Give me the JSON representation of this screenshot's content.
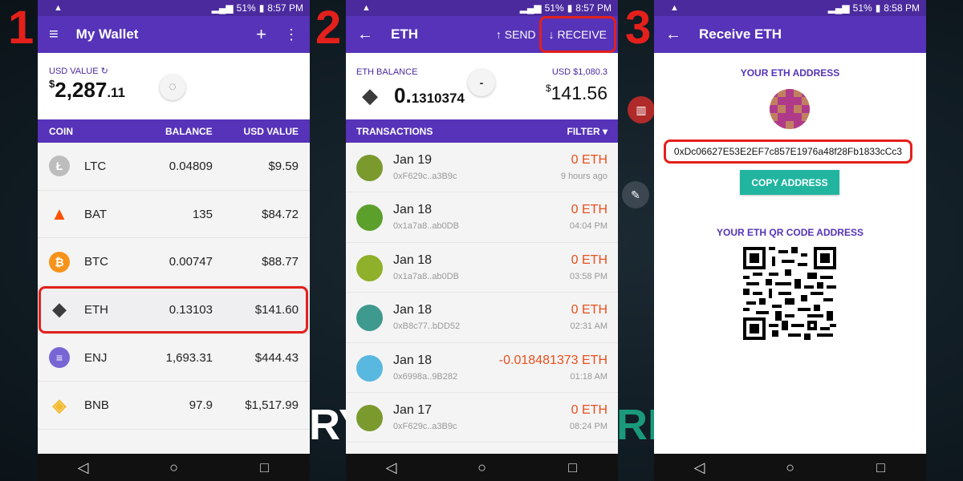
{
  "steps": [
    "1",
    "2",
    "3"
  ],
  "background_text": {
    "left": "RY",
    "right": "RE"
  },
  "status_bar": {
    "phone1": {
      "battery": "51%",
      "time": "8:57 PM"
    },
    "phone2": {
      "battery": "51%",
      "time": "8:57 PM"
    },
    "phone3": {
      "battery": "51%",
      "time": "8:58 PM"
    }
  },
  "wallet": {
    "title": "My Wallet",
    "usd_value_label": "USD VALUE",
    "usd_value_main": "2,287",
    "usd_value_cents": ".11",
    "headers": {
      "coin": "COIN",
      "balance": "BALANCE",
      "usd_value": "USD VALUE"
    },
    "coins": [
      {
        "symbol": "LTC",
        "balance": "0.04809",
        "usd": "$9.59",
        "icon": "litecoin-icon",
        "color": "#bdbdbd"
      },
      {
        "symbol": "BAT",
        "balance": "135",
        "usd": "$84.72",
        "icon": "bat-icon",
        "color": "#ff5000"
      },
      {
        "symbol": "BTC",
        "balance": "0.00747",
        "usd": "$88.77",
        "icon": "bitcoin-icon",
        "color": "#f7931a"
      },
      {
        "symbol": "ETH",
        "balance": "0.13103",
        "usd": "$141.60",
        "icon": "ethereum-icon",
        "color": "#3c3c3d"
      },
      {
        "symbol": "ENJ",
        "balance": "1,693.31",
        "usd": "$444.43",
        "icon": "enjin-icon",
        "color": "#7866d5"
      },
      {
        "symbol": "BNB",
        "balance": "97.9",
        "usd": "$1,517.99",
        "icon": "binance-icon",
        "color": "#f3ba2f"
      }
    ]
  },
  "eth": {
    "title": "ETH",
    "send_label": "SEND",
    "receive_label": "RECEIVE",
    "balance_label": "ETH BALANCE",
    "balance_main": "0.",
    "balance_rest": "1310374",
    "usd_label": "USD $1,080.3",
    "usd_value": "141.56",
    "transactions_label": "TRANSACTIONS",
    "filter_label": "FILTER",
    "transactions": [
      {
        "date": "Jan 19",
        "addr": "0xF629c..a3B9c",
        "amount": "0 ETH",
        "time": "9 hours ago",
        "color": "#7a9a2e"
      },
      {
        "date": "Jan 18",
        "addr": "0x1a7a8..ab0DB",
        "amount": "0 ETH",
        "time": "04:04 PM",
        "color": "#5ca02c"
      },
      {
        "date": "Jan 18",
        "addr": "0x1a7a8..ab0DB",
        "amount": "0 ETH",
        "time": "03:58 PM",
        "color": "#8fb02a"
      },
      {
        "date": "Jan 18",
        "addr": "0xB8c77..bDD52",
        "amount": "0 ETH",
        "time": "02:31 AM",
        "color": "#3e9a8e"
      },
      {
        "date": "Jan 18",
        "addr": "0x6998a..9B282",
        "amount": "-0.018481373 ETH",
        "time": "01:18 AM",
        "color": "#58b8e0"
      },
      {
        "date": "Jan 17",
        "addr": "0xF629c..a3B9c",
        "amount": "0 ETH",
        "time": "08:24 PM",
        "color": "#7a9a2e"
      }
    ]
  },
  "receive": {
    "title": "Receive ETH",
    "address_label": "YOUR ETH ADDRESS",
    "address": "0xDc06627E53E2EF7c857E1976a48f28Fb1833cCc3",
    "copy_label": "COPY ADDRESS",
    "qr_label": "YOUR ETH QR CODE ADDRESS"
  }
}
